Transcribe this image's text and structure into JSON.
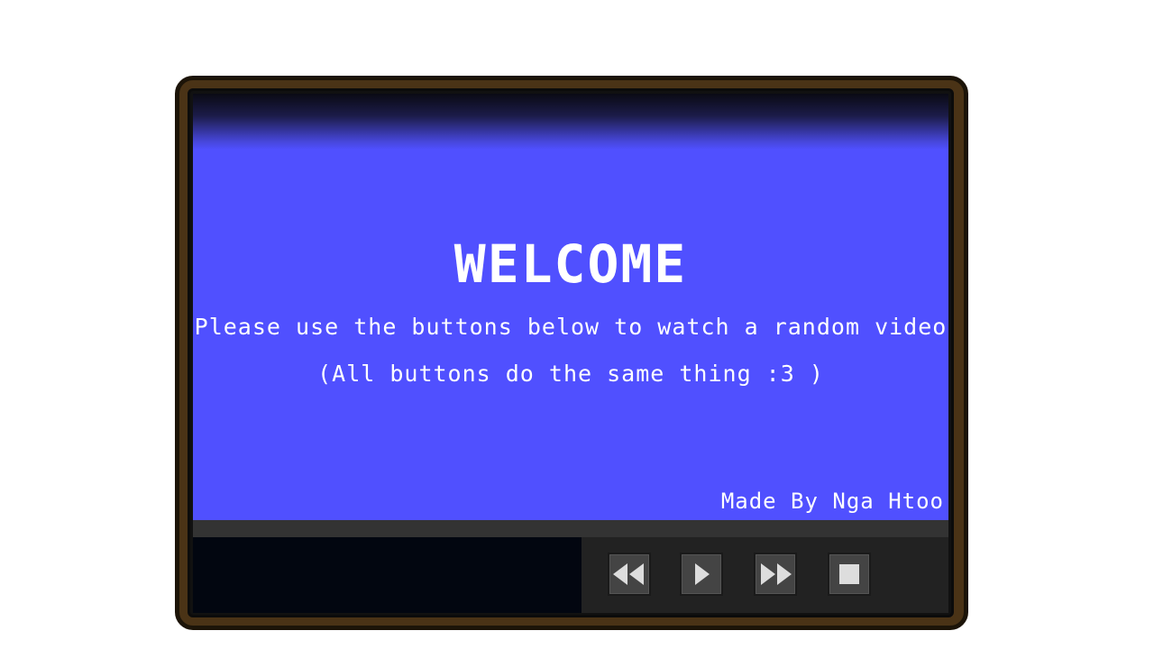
{
  "screen": {
    "title": "WELCOME",
    "subtitle": "Please use the buttons below to watch a random video",
    "note": "(All buttons do the same thing :3 )",
    "credit": "Made By Nga Htoo"
  },
  "controls": {
    "buttons": [
      {
        "name": "rewind",
        "icon": "rewind-icon"
      },
      {
        "name": "play",
        "icon": "play-icon"
      },
      {
        "name": "fast-forward",
        "icon": "fast-forward-icon"
      },
      {
        "name": "stop",
        "icon": "stop-icon"
      }
    ]
  },
  "colors": {
    "screen": "#5050ff",
    "frame": "#4a3316",
    "control_bar": "#222222",
    "button": "#444444",
    "icon": "#dddddd"
  }
}
